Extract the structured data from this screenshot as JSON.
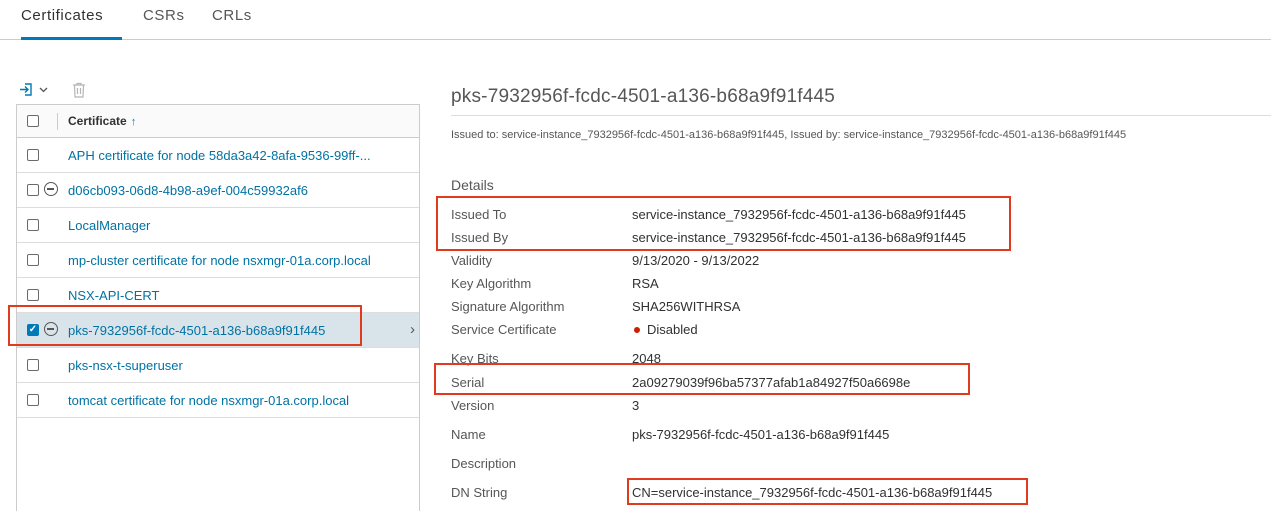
{
  "tabs": [
    {
      "label": "Certificates",
      "active": true
    },
    {
      "label": "CSRs",
      "active": false
    },
    {
      "label": "CRLs",
      "active": false
    }
  ],
  "toolbar": {
    "import_icon": "import-icon",
    "dropdown_icon": "chevron-down-icon",
    "delete_icon": "trash-icon"
  },
  "list": {
    "header_label": "Certificate",
    "sort_icon": "sort-ascending-icon",
    "items": [
      {
        "label": "APH certificate for node 58da3a42-8afa-9536-99ff-...",
        "checked": false,
        "has_status_icon": false
      },
      {
        "label": "d06cb093-06d8-4b98-a9ef-004c59932af6",
        "checked": false,
        "has_status_icon": true
      },
      {
        "label": "LocalManager",
        "checked": false,
        "has_status_icon": false
      },
      {
        "label": "mp-cluster certificate for node nsxmgr-01a.corp.local",
        "checked": false,
        "has_status_icon": false
      },
      {
        "label": "NSX-API-CERT",
        "checked": false,
        "has_status_icon": false
      },
      {
        "label": "pks-7932956f-fcdc-4501-a136-b68a9f91f445",
        "checked": true,
        "has_status_icon": true,
        "selected": true
      },
      {
        "label": "pks-nsx-t-superuser",
        "checked": false,
        "has_status_icon": false
      },
      {
        "label": "tomcat certificate for node nsxmgr-01a.corp.local",
        "checked": false,
        "has_status_icon": false
      }
    ]
  },
  "detail": {
    "title": "pks-7932956f-fcdc-4501-a136-b68a9f91f445",
    "issued_line": "Issued to: service-instance_7932956f-fcdc-4501-a136-b68a9f91f445, Issued by: service-instance_7932956f-fcdc-4501-a136-b68a9f91f445",
    "section": "Details",
    "fields": {
      "issued_to": {
        "key": "Issued To",
        "value": "service-instance_7932956f-fcdc-4501-a136-b68a9f91f445"
      },
      "issued_by": {
        "key": "Issued By",
        "value": "service-instance_7932956f-fcdc-4501-a136-b68a9f91f445"
      },
      "validity": {
        "key": "Validity",
        "value": "9/13/2020 - 9/13/2022"
      },
      "key_algorithm": {
        "key": "Key Algorithm",
        "value": "RSA"
      },
      "signature_algorithm": {
        "key": "Signature Algorithm",
        "value": "SHA256WITHRSA"
      },
      "service_certificate": {
        "key": "Service Certificate",
        "value": "Disabled"
      },
      "key_bits": {
        "key": "Key Bits",
        "value": "2048"
      },
      "serial": {
        "key": "Serial",
        "value": "2a09279039f96ba57377afab1a84927f50a6698e"
      },
      "version": {
        "key": "Version",
        "value": "3"
      },
      "name": {
        "key": "Name",
        "value": "pks-7932956f-fcdc-4501-a136-b68a9f91f445"
      },
      "description": {
        "key": "Description",
        "value": ""
      },
      "dn_string": {
        "key": "DN String",
        "value": "CN=service-instance_7932956f-fcdc-4501-a136-b68a9f91f445"
      }
    }
  },
  "colors": {
    "accent": "#0079b8",
    "link": "#0072a3",
    "highlight": "#e03b1f",
    "disabled_dot": "#c92100",
    "selected_row": "#d9e4ea"
  }
}
